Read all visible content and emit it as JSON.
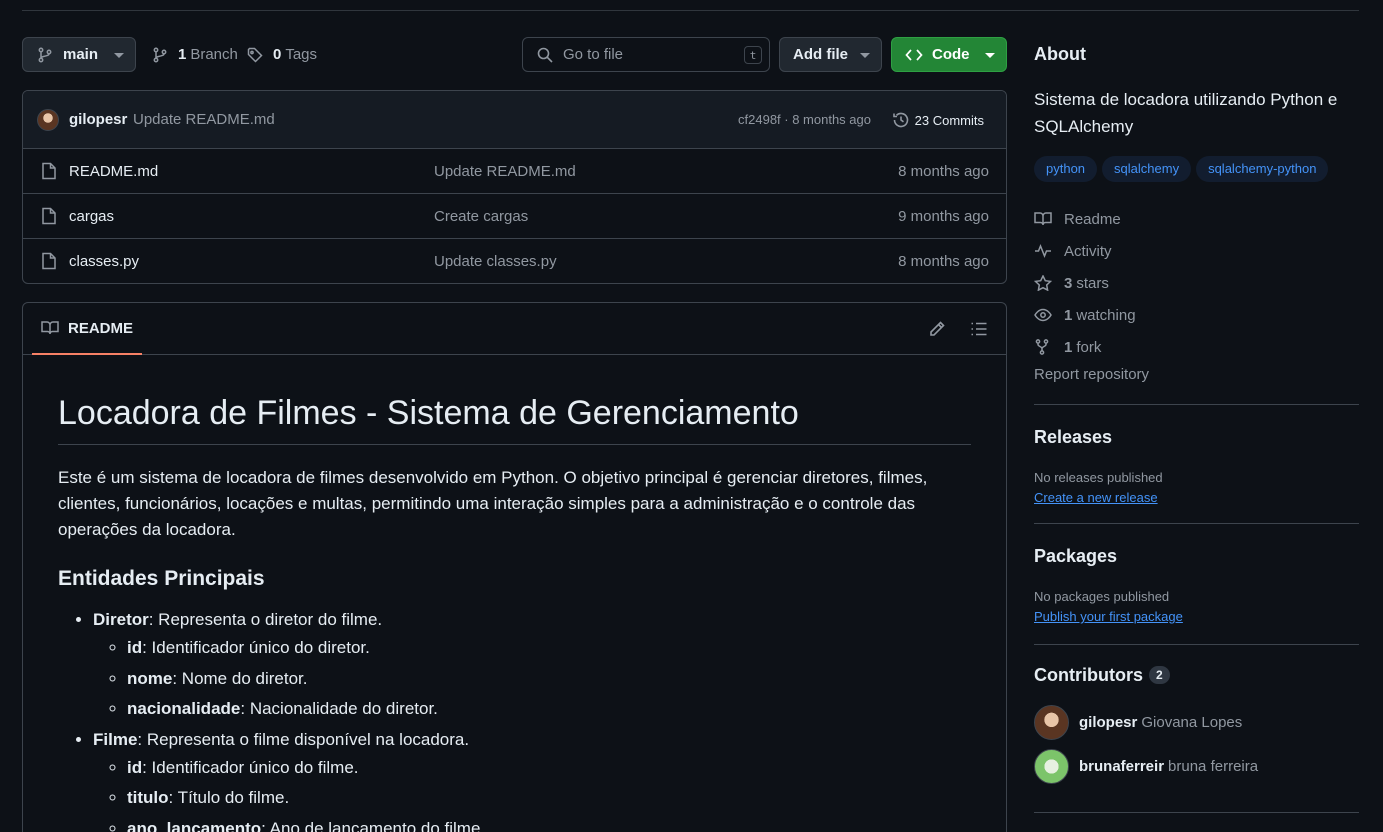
{
  "toolbar": {
    "branch": "main",
    "branches_count": "1",
    "branches_label": "Branch",
    "tags_count": "0",
    "tags_label": "Tags",
    "goto_placeholder": "Go to file",
    "goto_kbd": "t",
    "add_file": "Add file",
    "code": "Code"
  },
  "commit": {
    "user": "gilopesr",
    "message": "Update README.md",
    "hash_time": "cf2498f · 8 months ago",
    "commits": "23 Commits"
  },
  "files": [
    {
      "name": "README.md",
      "message": "Update README.md",
      "date": "8 months ago"
    },
    {
      "name": "cargas",
      "message": "Create cargas",
      "date": "9 months ago"
    },
    {
      "name": "classes.py",
      "message": "Update classes.py",
      "date": "8 months ago"
    }
  ],
  "readme": {
    "tab": "README",
    "title": "Locadora de Filmes - Sistema de Gerenciamento",
    "intro": "Este é um sistema de locadora de filmes desenvolvido em Python. O objetivo principal é gerenciar diretores, filmes, clientes, funcionários, locações e multas, permitindo uma interação simples para a administração e o controle das operações da locadora.",
    "section": "Entidades Principais",
    "entities": [
      {
        "name": "Diretor",
        "desc": ": Representa o diretor do filme.",
        "fields": [
          {
            "name": "id",
            "desc": ": Identificador único do diretor."
          },
          {
            "name": "nome",
            "desc": ": Nome do diretor."
          },
          {
            "name": "nacionalidade",
            "desc": ": Nacionalidade do diretor."
          }
        ]
      },
      {
        "name": "Filme",
        "desc": ": Representa o filme disponível na locadora.",
        "fields": [
          {
            "name": "id",
            "desc": ": Identificador único do filme."
          },
          {
            "name": "titulo",
            "desc": ": Título do filme."
          },
          {
            "name": "ano_lancamento",
            "desc": ": Ano de lançamento do filme."
          }
        ]
      }
    ]
  },
  "about": {
    "title": "About",
    "description": "Sistema de locadora utilizando Python e SQLAlchemy",
    "topics": [
      "python",
      "sqlalchemy",
      "sqlalchemy-python"
    ],
    "links": {
      "readme": "Readme",
      "activity": "Activity",
      "stars_count": "3",
      "stars_label": "stars",
      "watching_count": "1",
      "watching_label": "watching",
      "fork_count": "1",
      "fork_label": "fork"
    },
    "report": "Report repository"
  },
  "releases": {
    "title": "Releases",
    "empty": "No releases published",
    "link": "Create a new release"
  },
  "packages": {
    "title": "Packages",
    "empty": "No packages published",
    "link": "Publish your first package"
  },
  "contributors": {
    "title": "Contributors",
    "count": "2",
    "list": [
      {
        "user": "gilopesr",
        "name": "Giovana Lopes"
      },
      {
        "user": "brunaferreir",
        "name": "bruna ferreira"
      }
    ]
  },
  "colors": {
    "accent_green": "#238636",
    "link_blue": "#4493f8",
    "tab_underline": "#f78166"
  }
}
